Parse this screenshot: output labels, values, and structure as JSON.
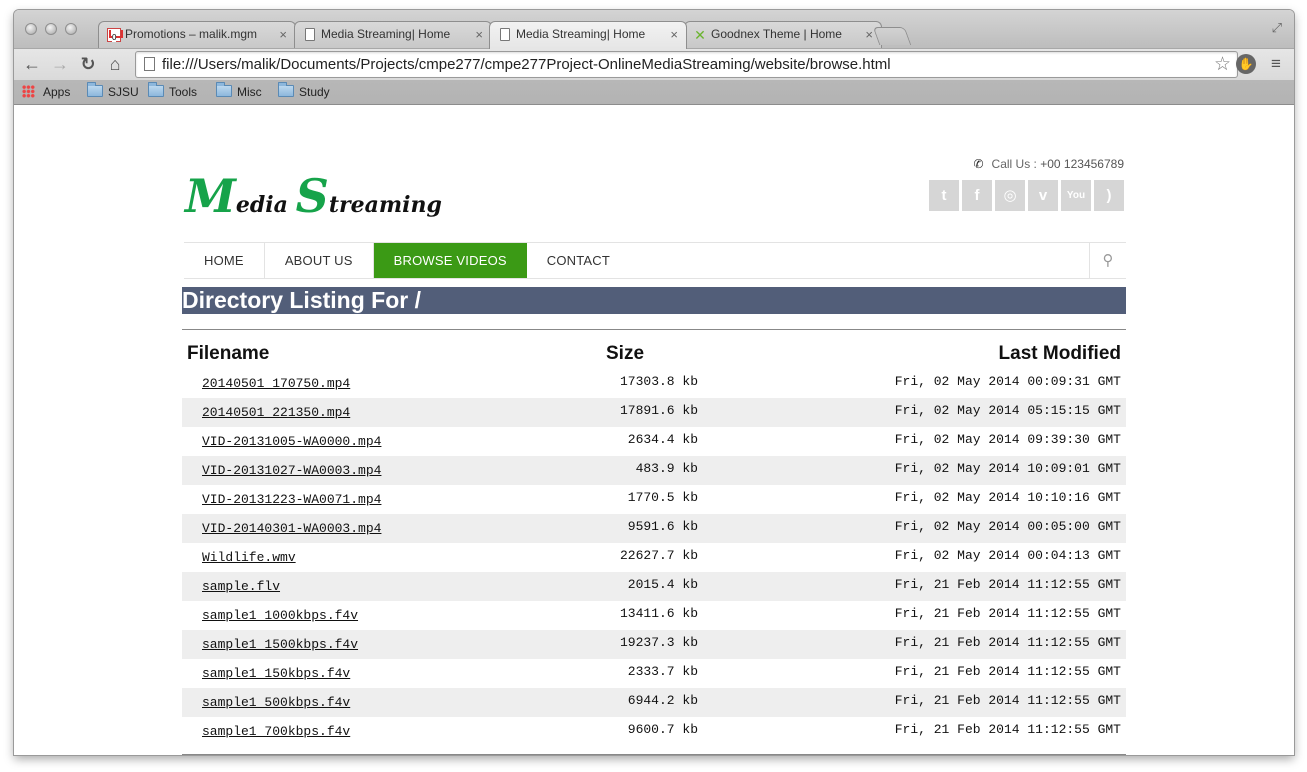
{
  "browser": {
    "tabs": [
      {
        "title": "Promotions – malik.mgm",
        "icon": "gmail-icon",
        "active": false
      },
      {
        "title": "Media Streaming| Home",
        "icon": "document-icon",
        "active": false
      },
      {
        "title": "Media Streaming| Home",
        "icon": "document-icon",
        "active": true
      },
      {
        "title": "Goodnex Theme | Home",
        "icon": "goodnex-icon",
        "active": false
      }
    ],
    "tab_close": "×",
    "gmail_badge": "0",
    "url": "file:///Users/malik/Documents/Projects/cmpe277/cmpe277Project-OnlineMediaStreaming/website/browse.html",
    "bookmarks": [
      "Apps",
      "SJSU",
      "Tools",
      "Misc",
      "Study"
    ]
  },
  "site": {
    "call_label": "Call Us : ",
    "call_number": "+00 123456789",
    "social_icons": [
      "twitter-icon",
      "facebook-icon",
      "dribbble-icon",
      "vimeo-icon",
      "youtube-icon",
      "rss-icon"
    ],
    "logo": {
      "m": "M",
      "edia": "edia ",
      "s": "S",
      "treaming": "treaming"
    },
    "nav": [
      {
        "label": "HOME",
        "active": false
      },
      {
        "label": "ABOUT US",
        "active": false
      },
      {
        "label": "BROWSE VIDEOS",
        "active": true
      },
      {
        "label": "CONTACT",
        "active": false
      }
    ],
    "accent_color": "#3b9a15",
    "title_bar_color": "#525e79"
  },
  "listing": {
    "title": "Directory Listing For /",
    "headers": {
      "name": "Filename",
      "size": "Size",
      "modified": "Last Modified"
    },
    "rows": [
      {
        "name": "20140501_170750.mp4",
        "size": "17303.8 kb",
        "modified": "Fri, 02 May 2014 00:09:31 GMT"
      },
      {
        "name": "20140501_221350.mp4",
        "size": "17891.6 kb",
        "modified": "Fri, 02 May 2014 05:15:15 GMT"
      },
      {
        "name": "VID-20131005-WA0000.mp4",
        "size": "2634.4 kb",
        "modified": "Fri, 02 May 2014 09:39:30 GMT"
      },
      {
        "name": "VID-20131027-WA0003.mp4",
        "size": "483.9 kb",
        "modified": "Fri, 02 May 2014 10:09:01 GMT"
      },
      {
        "name": "VID-20131223-WA0071.mp4",
        "size": "1770.5 kb",
        "modified": "Fri, 02 May 2014 10:10:16 GMT"
      },
      {
        "name": "VID-20140301-WA0003.mp4",
        "size": "9591.6 kb",
        "modified": "Fri, 02 May 2014 00:05:00 GMT"
      },
      {
        "name": "Wildlife.wmv",
        "size": "22627.7 kb",
        "modified": "Fri, 02 May 2014 00:04:13 GMT"
      },
      {
        "name": "sample.flv",
        "size": "2015.4 kb",
        "modified": "Fri, 21 Feb 2014 11:12:55 GMT"
      },
      {
        "name": "sample1_1000kbps.f4v",
        "size": "13411.6 kb",
        "modified": "Fri, 21 Feb 2014 11:12:55 GMT"
      },
      {
        "name": "sample1_1500kbps.f4v",
        "size": "19237.3 kb",
        "modified": "Fri, 21 Feb 2014 11:12:55 GMT"
      },
      {
        "name": "sample1_150kbps.f4v",
        "size": "2333.7 kb",
        "modified": "Fri, 21 Feb 2014 11:12:55 GMT"
      },
      {
        "name": "sample1_500kbps.f4v",
        "size": "6944.2 kb",
        "modified": "Fri, 21 Feb 2014 11:12:55 GMT"
      },
      {
        "name": "sample1_700kbps.f4v",
        "size": "9600.7 kb",
        "modified": "Fri, 21 Feb 2014 11:12:55 GMT"
      }
    ]
  }
}
